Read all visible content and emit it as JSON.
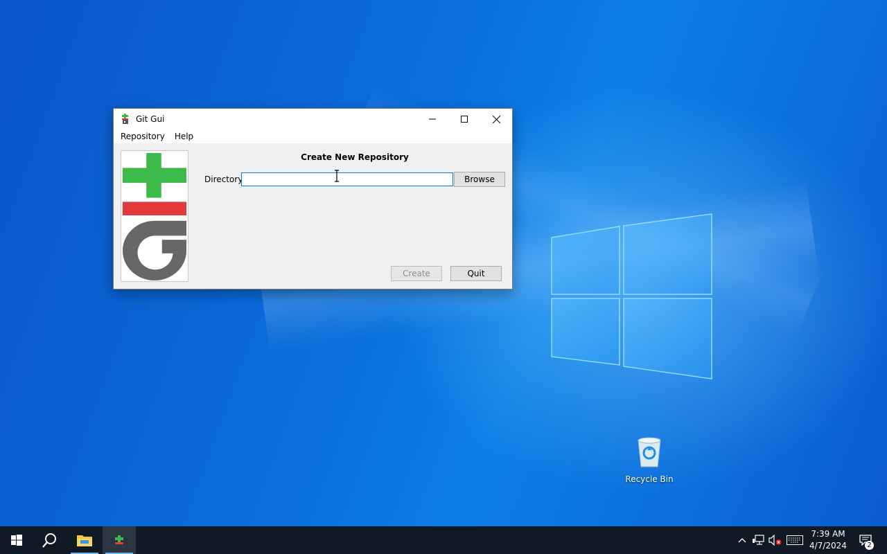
{
  "window": {
    "title": "Git Gui",
    "menu": [
      "Repository",
      "Help"
    ]
  },
  "dialog": {
    "heading": "Create New Repository",
    "directory_label": "Directory:",
    "directory_value": "",
    "browse_label": "Browse",
    "create_label": "Create",
    "quit_label": "Quit"
  },
  "desktop": {
    "recycle_bin_label": "Recycle Bin"
  },
  "taskbar": {
    "time": "7:39 AM",
    "date": "4/7/2024",
    "notification_count": "2",
    "pinned": [
      "start-icon",
      "search-icon",
      "file-explorer-icon",
      "git-gui-icon"
    ],
    "tray": [
      "chevron-up-icon",
      "network-icon",
      "volume-muted-icon",
      "keyboard-icon"
    ]
  },
  "colors": {
    "git_green": "#3cba49",
    "git_red": "#e03a3a",
    "git_gray": "#676767",
    "input_focus": "#0078d7",
    "taskbar": "#101a24"
  }
}
